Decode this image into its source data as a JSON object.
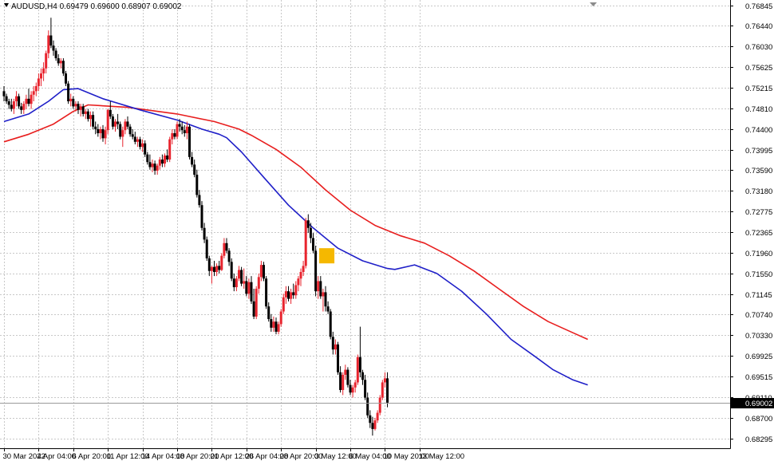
{
  "window": {
    "symbol_label": "AUDUSD,H4  0.69479 0.69600 0.68907 0.69002"
  },
  "colors": {
    "background": "#ffffff",
    "grid": "#c8c8c8",
    "bull_candle": "#e8242e",
    "bear_candle": "#000000",
    "ma_fast": "#1f1fc8",
    "ma_slow": "#e81e1e",
    "price_line": "#9a9a9a",
    "price_tag": "#000000",
    "marker": "#f5b800"
  },
  "chart_data": {
    "type": "candlestick",
    "symbol": "AUDUSD",
    "timeframe": "H4",
    "ohlc_header": {
      "open": 0.69479,
      "high": 0.696,
      "low": 0.68907,
      "close": 0.69002
    },
    "current_price": 0.69002,
    "current_price_label": "0.69002",
    "ylim": [
      0.681,
      0.7695
    ],
    "y_ticks": [
      0.76845,
      0.7644,
      0.7603,
      0.75625,
      0.75215,
      0.7481,
      0.744,
      0.73995,
      0.7359,
      0.7318,
      0.72775,
      0.72365,
      0.7196,
      0.7155,
      0.71145,
      0.7074,
      0.7033,
      0.69925,
      0.69515,
      0.6911,
      0.687,
      0.68295
    ],
    "y_tick_labels": [
      "0.76845",
      "0.76440",
      "0.76030",
      "0.75625",
      "0.75215",
      "0.74810",
      "0.74400",
      "0.73995",
      "0.73590",
      "0.73180",
      "0.72775",
      "0.72365",
      "0.71960",
      "0.71550",
      "0.71145",
      "0.70740",
      "0.70330",
      "0.69925",
      "0.69515",
      "0.69110",
      "0.68700",
      "0.68295"
    ],
    "x_tick_labels": [
      "30 Mar 2022",
      "4 Apr 04:00",
      "6 Apr 20:00",
      "11 Apr 12:00",
      "14 Apr 04:00",
      "18 Apr 20:00",
      "21 Apr 12:00",
      "26 Apr 04:00",
      "28 Apr 20:00",
      "3 May 12:00",
      "6 May 04:00",
      "10 May 20:00",
      "13 May 12:00"
    ],
    "x_tick_index": [
      0,
      14,
      28,
      42,
      56,
      70,
      84,
      98,
      112,
      126,
      140,
      154,
      168
    ],
    "candles": [
      [
        0.7515,
        0.7525,
        0.7495,
        0.7505
      ],
      [
        0.7505,
        0.751,
        0.749,
        0.7495
      ],
      [
        0.7495,
        0.75,
        0.748,
        0.7488
      ],
      [
        0.7488,
        0.75,
        0.7475,
        0.748
      ],
      [
        0.748,
        0.75,
        0.747,
        0.7495
      ],
      [
        0.7495,
        0.7515,
        0.7485,
        0.7505
      ],
      [
        0.7505,
        0.751,
        0.748,
        0.7485
      ],
      [
        0.7485,
        0.7492,
        0.747,
        0.7478
      ],
      [
        0.7478,
        0.7495,
        0.747,
        0.749
      ],
      [
        0.749,
        0.7508,
        0.748,
        0.75
      ],
      [
        0.75,
        0.752,
        0.7485,
        0.749
      ],
      [
        0.749,
        0.7515,
        0.748,
        0.7508
      ],
      [
        0.7508,
        0.7525,
        0.7495,
        0.7515
      ],
      [
        0.7515,
        0.7532,
        0.7505,
        0.7525
      ],
      [
        0.7525,
        0.755,
        0.7515,
        0.754
      ],
      [
        0.754,
        0.756,
        0.7525,
        0.755
      ],
      [
        0.755,
        0.7572,
        0.7535,
        0.756
      ],
      [
        0.756,
        0.7595,
        0.755,
        0.759
      ],
      [
        0.759,
        0.7635,
        0.758,
        0.7625
      ],
      [
        0.7625,
        0.766,
        0.76,
        0.7605
      ],
      [
        0.7605,
        0.7615,
        0.7585,
        0.7595
      ],
      [
        0.7595,
        0.76,
        0.7575,
        0.758
      ],
      [
        0.758,
        0.7588,
        0.7565,
        0.757
      ],
      [
        0.757,
        0.758,
        0.756,
        0.7575
      ],
      [
        0.7575,
        0.758,
        0.7545,
        0.755
      ],
      [
        0.755,
        0.7555,
        0.7525,
        0.753
      ],
      [
        0.753,
        0.7535,
        0.749,
        0.7495
      ],
      [
        0.7495,
        0.751,
        0.7485,
        0.75
      ],
      [
        0.75,
        0.7505,
        0.748,
        0.7485
      ],
      [
        0.7485,
        0.7495,
        0.7475,
        0.749
      ],
      [
        0.749,
        0.7495,
        0.747,
        0.7478
      ],
      [
        0.7478,
        0.749,
        0.7465,
        0.7485
      ],
      [
        0.7485,
        0.749,
        0.7465,
        0.747
      ],
      [
        0.747,
        0.748,
        0.746,
        0.7475
      ],
      [
        0.7475,
        0.748,
        0.7455,
        0.746
      ],
      [
        0.746,
        0.7475,
        0.7445,
        0.7468
      ],
      [
        0.7468,
        0.7475,
        0.744,
        0.7445
      ],
      [
        0.7445,
        0.7455,
        0.743,
        0.744
      ],
      [
        0.744,
        0.745,
        0.7425,
        0.7432
      ],
      [
        0.7432,
        0.7445,
        0.742,
        0.744
      ],
      [
        0.744,
        0.7448,
        0.7415,
        0.7422
      ],
      [
        0.7422,
        0.7445,
        0.741,
        0.7438
      ],
      [
        0.7438,
        0.748,
        0.743,
        0.7478
      ],
      [
        0.7478,
        0.7495,
        0.746,
        0.7465
      ],
      [
        0.7465,
        0.747,
        0.744,
        0.7445
      ],
      [
        0.7445,
        0.746,
        0.7435,
        0.7455
      ],
      [
        0.7455,
        0.747,
        0.744,
        0.745
      ],
      [
        0.745,
        0.7455,
        0.742,
        0.7425
      ],
      [
        0.7425,
        0.7445,
        0.7405,
        0.7438
      ],
      [
        0.7438,
        0.746,
        0.743,
        0.7455
      ],
      [
        0.7455,
        0.7465,
        0.744,
        0.7445
      ],
      [
        0.7445,
        0.745,
        0.7425,
        0.743
      ],
      [
        0.743,
        0.744,
        0.742,
        0.7425
      ],
      [
        0.7425,
        0.7435,
        0.741,
        0.7415
      ],
      [
        0.7415,
        0.7425,
        0.7405,
        0.742
      ],
      [
        0.742,
        0.7425,
        0.74,
        0.7405
      ],
      [
        0.7405,
        0.742,
        0.7395,
        0.7412
      ],
      [
        0.7412,
        0.7418,
        0.7385,
        0.739
      ],
      [
        0.739,
        0.7395,
        0.737,
        0.7375
      ],
      [
        0.7375,
        0.739,
        0.736,
        0.7365
      ],
      [
        0.7365,
        0.738,
        0.7355,
        0.7372
      ],
      [
        0.7372,
        0.7378,
        0.735,
        0.7358
      ],
      [
        0.7358,
        0.7372,
        0.735,
        0.7368
      ],
      [
        0.7368,
        0.7385,
        0.736,
        0.738
      ],
      [
        0.738,
        0.739,
        0.7365,
        0.7372
      ],
      [
        0.7372,
        0.7392,
        0.7365,
        0.7388
      ],
      [
        0.7388,
        0.74,
        0.7375,
        0.738
      ],
      [
        0.738,
        0.7425,
        0.7375,
        0.742
      ],
      [
        0.742,
        0.744,
        0.741,
        0.7432
      ],
      [
        0.7432,
        0.744,
        0.742,
        0.7425
      ],
      [
        0.7425,
        0.7455,
        0.742,
        0.745
      ],
      [
        0.745,
        0.746,
        0.7435,
        0.7445
      ],
      [
        0.7445,
        0.7455,
        0.743,
        0.7438
      ],
      [
        0.7438,
        0.7448,
        0.7425,
        0.7432
      ],
      [
        0.7432,
        0.7455,
        0.742,
        0.7445
      ],
      [
        0.7445,
        0.745,
        0.738,
        0.7385
      ],
      [
        0.7385,
        0.7395,
        0.7365,
        0.737
      ],
      [
        0.737,
        0.738,
        0.7345,
        0.735
      ],
      [
        0.735,
        0.736,
        0.7305,
        0.731
      ],
      [
        0.731,
        0.732,
        0.7285,
        0.729
      ],
      [
        0.729,
        0.7298,
        0.724,
        0.7245
      ],
      [
        0.7245,
        0.7255,
        0.7215,
        0.7222
      ],
      [
        0.7222,
        0.7228,
        0.718,
        0.7185
      ],
      [
        0.7185,
        0.719,
        0.715,
        0.716
      ],
      [
        0.716,
        0.717,
        0.7135,
        0.7168
      ],
      [
        0.7168,
        0.718,
        0.715,
        0.7158
      ],
      [
        0.7158,
        0.7175,
        0.715,
        0.717
      ],
      [
        0.717,
        0.718,
        0.7155,
        0.7162
      ],
      [
        0.7162,
        0.7195,
        0.716,
        0.719
      ],
      [
        0.719,
        0.7225,
        0.7185,
        0.7215
      ],
      [
        0.7215,
        0.7225,
        0.7195,
        0.72
      ],
      [
        0.72,
        0.7205,
        0.717,
        0.7178
      ],
      [
        0.7178,
        0.7185,
        0.714,
        0.7145
      ],
      [
        0.7145,
        0.7155,
        0.712,
        0.7128
      ],
      [
        0.7128,
        0.715,
        0.712,
        0.7145
      ],
      [
        0.7145,
        0.717,
        0.714,
        0.7162
      ],
      [
        0.7162,
        0.7168,
        0.713,
        0.7135
      ],
      [
        0.7135,
        0.7165,
        0.7125,
        0.714
      ],
      [
        0.714,
        0.715,
        0.711,
        0.7115
      ],
      [
        0.7115,
        0.7145,
        0.7105,
        0.7138
      ],
      [
        0.7138,
        0.715,
        0.7095,
        0.71
      ],
      [
        0.71,
        0.7125,
        0.7065,
        0.707
      ],
      [
        0.707,
        0.713,
        0.7065,
        0.7125
      ],
      [
        0.7125,
        0.7155,
        0.7115,
        0.7148
      ],
      [
        0.7148,
        0.718,
        0.714,
        0.7172
      ],
      [
        0.7172,
        0.7178,
        0.714,
        0.7145
      ],
      [
        0.7145,
        0.715,
        0.7085,
        0.709
      ],
      [
        0.709,
        0.7098,
        0.706,
        0.7065
      ],
      [
        0.7065,
        0.7075,
        0.704,
        0.7048
      ],
      [
        0.7048,
        0.707,
        0.704,
        0.706
      ],
      [
        0.706,
        0.7068,
        0.7035,
        0.704
      ],
      [
        0.704,
        0.706,
        0.7035,
        0.7055
      ],
      [
        0.7055,
        0.7085,
        0.705,
        0.708
      ],
      [
        0.708,
        0.7115,
        0.7075,
        0.7108
      ],
      [
        0.7108,
        0.713,
        0.7095,
        0.712
      ],
      [
        0.712,
        0.713,
        0.71,
        0.7105
      ],
      [
        0.7105,
        0.7125,
        0.7095,
        0.7118
      ],
      [
        0.7118,
        0.7135,
        0.7105,
        0.7112
      ],
      [
        0.7112,
        0.714,
        0.7105,
        0.7132
      ],
      [
        0.7132,
        0.715,
        0.712,
        0.7145
      ],
      [
        0.7145,
        0.7165,
        0.713,
        0.7158
      ],
      [
        0.7158,
        0.718,
        0.715,
        0.717
      ],
      [
        0.717,
        0.7265,
        0.7165,
        0.726
      ],
      [
        0.726,
        0.7272,
        0.7235,
        0.7245
      ],
      [
        0.7245,
        0.7255,
        0.7215,
        0.7225
      ],
      [
        0.7225,
        0.7235,
        0.7195,
        0.72
      ],
      [
        0.72,
        0.721,
        0.711,
        0.712
      ],
      [
        0.712,
        0.715,
        0.7105,
        0.714
      ],
      [
        0.714,
        0.715,
        0.7105,
        0.711
      ],
      [
        0.711,
        0.7125,
        0.708,
        0.7118
      ],
      [
        0.7118,
        0.713,
        0.708,
        0.709
      ],
      [
        0.709,
        0.71,
        0.7075,
        0.708
      ],
      [
        0.708,
        0.7085,
        0.7025,
        0.703
      ],
      [
        0.703,
        0.704,
        0.6995,
        0.7005
      ],
      [
        0.7005,
        0.7025,
        0.6995,
        0.7015
      ],
      [
        0.7015,
        0.702,
        0.6955,
        0.696
      ],
      [
        0.696,
        0.6972,
        0.692,
        0.6925
      ],
      [
        0.6925,
        0.696,
        0.6915,
        0.6955
      ],
      [
        0.6955,
        0.6975,
        0.6945,
        0.6965
      ],
      [
        0.6965,
        0.697,
        0.693,
        0.6935
      ],
      [
        0.6935,
        0.6945,
        0.6915,
        0.692
      ],
      [
        0.692,
        0.6935,
        0.691,
        0.693
      ],
      [
        0.693,
        0.6945,
        0.692,
        0.694
      ],
      [
        0.694,
        0.6995,
        0.6935,
        0.699
      ],
      [
        0.699,
        0.705,
        0.695,
        0.696
      ],
      [
        0.696,
        0.6965,
        0.6935,
        0.6945
      ],
      [
        0.6945,
        0.6955,
        0.6905,
        0.691
      ],
      [
        0.691,
        0.692,
        0.687,
        0.6875
      ],
      [
        0.6875,
        0.6885,
        0.685,
        0.686
      ],
      [
        0.686,
        0.6872,
        0.6835,
        0.6848
      ],
      [
        0.6848,
        0.687,
        0.6845,
        0.6865
      ],
      [
        0.6865,
        0.6885,
        0.686,
        0.688
      ],
      [
        0.688,
        0.6915,
        0.6875,
        0.691
      ],
      [
        0.691,
        0.6945,
        0.6905,
        0.694
      ],
      [
        0.694,
        0.696,
        0.693,
        0.6948
      ],
      [
        0.6948,
        0.696,
        0.6891,
        0.69
      ]
    ],
    "ma_fast": {
      "color": "#1f1fc8",
      "points": [
        [
          0,
          0.7455
        ],
        [
          10,
          0.747
        ],
        [
          18,
          0.7495
        ],
        [
          24,
          0.7518
        ],
        [
          30,
          0.752
        ],
        [
          40,
          0.75
        ],
        [
          55,
          0.7478
        ],
        [
          70,
          0.7458
        ],
        [
          80,
          0.744
        ],
        [
          87,
          0.743
        ],
        [
          90,
          0.7423
        ],
        [
          96,
          0.7395
        ],
        [
          105,
          0.7345
        ],
        [
          115,
          0.729
        ],
        [
          125,
          0.7245
        ],
        [
          135,
          0.7205
        ],
        [
          145,
          0.718
        ],
        [
          155,
          0.7165
        ],
        [
          158,
          0.7163
        ],
        [
          166,
          0.7172
        ],
        [
          175,
          0.7155
        ],
        [
          185,
          0.712
        ],
        [
          195,
          0.7075
        ],
        [
          205,
          0.7025
        ],
        [
          215,
          0.699
        ],
        [
          222,
          0.6965
        ],
        [
          230,
          0.6945
        ],
        [
          236,
          0.6935
        ]
      ]
    },
    "ma_slow": {
      "color": "#e81e1e",
      "points": [
        [
          0,
          0.7415
        ],
        [
          10,
          0.743
        ],
        [
          20,
          0.745
        ],
        [
          28,
          0.7475
        ],
        [
          34,
          0.7488
        ],
        [
          50,
          0.7483
        ],
        [
          70,
          0.747
        ],
        [
          85,
          0.7455
        ],
        [
          95,
          0.744
        ],
        [
          100,
          0.7428
        ],
        [
          110,
          0.74
        ],
        [
          120,
          0.7365
        ],
        [
          130,
          0.732
        ],
        [
          140,
          0.728
        ],
        [
          150,
          0.725
        ],
        [
          160,
          0.723
        ],
        [
          170,
          0.7215
        ],
        [
          180,
          0.719
        ],
        [
          190,
          0.716
        ],
        [
          200,
          0.7125
        ],
        [
          210,
          0.709
        ],
        [
          220,
          0.706
        ],
        [
          230,
          0.7038
        ],
        [
          236,
          0.7025
        ]
      ]
    },
    "marker": {
      "x_index": 130.5,
      "y_high": 0.7205,
      "y_low": 0.7175
    }
  }
}
